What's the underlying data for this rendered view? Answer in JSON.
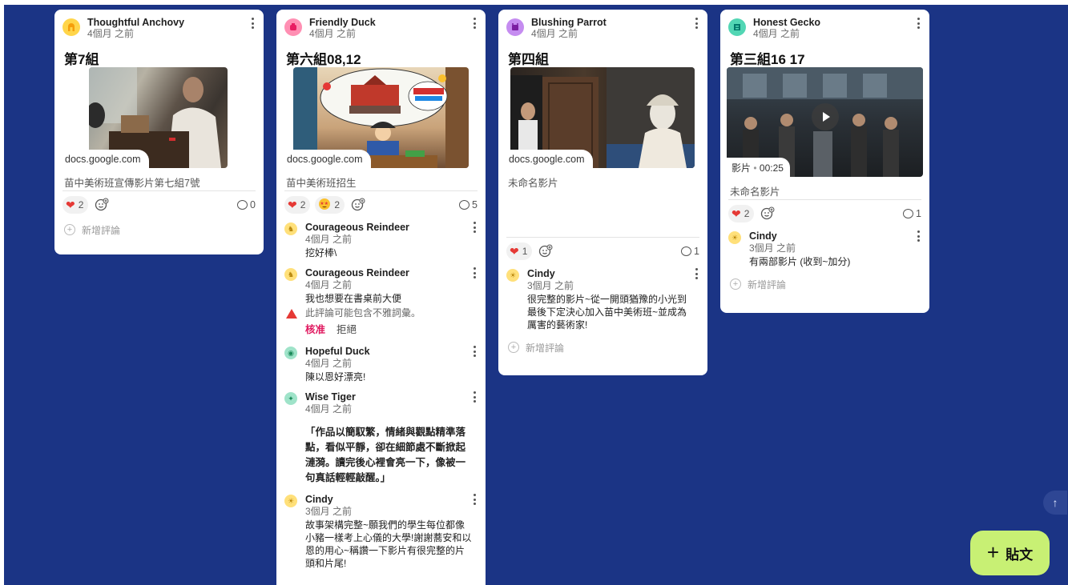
{
  "posts": [
    {
      "author": "Thoughtful Anchovy",
      "time": "4個月 之前",
      "title": "第7組",
      "link": "docs.google.com",
      "caption": "苗中美術班宣傳影片第七組7號",
      "reactions": {
        "heart": "2"
      },
      "comment_count": "0",
      "add_comment": "新增評論",
      "avatar_color": "#ffd54a"
    },
    {
      "author": "Friendly Duck",
      "time": "4個月 之前",
      "title": "第六組08,12",
      "link": "docs.google.com",
      "caption": "苗中美術班招生",
      "reactions": {
        "heart": "2",
        "star_eyes": "2"
      },
      "comment_count": "5",
      "avatar_color": "#ff8fb3",
      "comments": [
        {
          "author": "Courageous Reindeer",
          "time": "4個月 之前",
          "text": "挖好棒\\"
        },
        {
          "author": "Courageous Reindeer",
          "time": "4個月 之前",
          "text": "我也想要在書桌前大便",
          "warning": "此評論可能包含不雅詞彙。",
          "approve": "核准",
          "reject": "拒絕"
        },
        {
          "author": "Hopeful Duck",
          "time": "4個月 之前",
          "text": "陳以恩好漂亮!"
        },
        {
          "author": "Wise Tiger",
          "time": "4個月 之前",
          "text": "「作品以簡馭繁，情緒與觀點精準落點，看似平靜，卻在細節處不斷掀起漣漪。讀完後心裡會亮一下，像被一句真話輕輕敲醒。」"
        },
        {
          "author": "Cindy",
          "time": "3個月 之前",
          "text": "故事架構完整~願我們的學生每位都像小豬一樣考上心儀的大學!謝謝蕎安和以恩的用心~稱讚一下影片有很完整的片頭和片尾!"
        }
      ]
    },
    {
      "author": "Blushing Parrot",
      "time": "4個月 之前",
      "title": "第四組",
      "link": "docs.google.com",
      "caption": "未命名影片",
      "reactions": {
        "heart": "1"
      },
      "comment_count": "1",
      "add_comment": "新增評論",
      "avatar_color": "#c58cf0",
      "comments": [
        {
          "author": "Cindy",
          "time": "3個月 之前",
          "text": "很完整的影片~從一開頭猶豫的小光到最後下定決心加入苗中美術班~並成為厲害的藝術家!"
        }
      ]
    },
    {
      "author": "Honest Gecko",
      "time": "4個月 之前",
      "title": "第三組16 17",
      "video_label": "影片",
      "video_duration": "00:25",
      "caption": "未命名影片",
      "reactions": {
        "heart": "2"
      },
      "comment_count": "1",
      "add_comment": "新增評論",
      "avatar_color": "#52d6b4",
      "comments": [
        {
          "author": "Cindy",
          "time": "3個月 之前",
          "text": "有兩部影片 (收到~加分)"
        }
      ]
    }
  ],
  "fab": {
    "label": "貼文",
    "plus": "+"
  },
  "scroll_top_icon": "↑",
  "colors": {
    "board_bg": "#1b3485",
    "fab_bg": "#c8f074",
    "approve": "#e0185f"
  }
}
